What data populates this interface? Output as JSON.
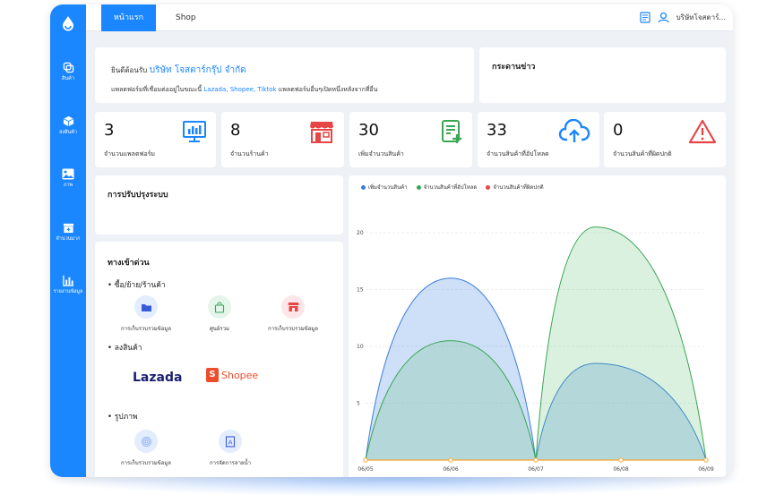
{
  "topbar": {
    "tabs": [
      {
        "label": "หน้าแรก"
      },
      {
        "label": "Shop"
      }
    ],
    "company": "บริษัทโจสตาร์..."
  },
  "sidebar": {
    "items": [
      {
        "label": "สินค้า"
      },
      {
        "label": "ลงสินค้า"
      },
      {
        "label": "ภาพ"
      },
      {
        "label": "จำนวนมาก"
      },
      {
        "label": "รายงานข้อมูล"
      }
    ]
  },
  "welcome": {
    "prefix": "ยินดีต้อนรับ",
    "company": "บริษัท โจสตาร์กรุ๊ป จำกัด",
    "line2_prefix": "แพลตฟอร์มที่เชื่อมต่ออยู่ในขณะนี้",
    "platforms": "Lazada, Shopee, Tiktok",
    "line2_suffix": "แพลตฟอร์มอื่นๆเปิดหนึ่งหลังจากที่อื่น"
  },
  "news": {
    "title": "กระดานข่าว"
  },
  "stats": [
    {
      "value": "3",
      "label": "จำนวนแพลตฟอร์ม"
    },
    {
      "value": "8",
      "label": "จำนวนร้านค้า"
    },
    {
      "value": "30",
      "label": "เพิ่มจำนวนสินค้า"
    },
    {
      "value": "33",
      "label": "จำนวนสินค้าที่อัปโหลด"
    },
    {
      "value": "0",
      "label": "จำนวนสินค้าที่ผิดปกติ"
    }
  ],
  "updates": {
    "title": "การปรับปรุงระบบ"
  },
  "quick_access": {
    "title": "ทางเข้าด่วน",
    "sections": [
      {
        "label": "• ซื้อ/ย้าย/ร้านค้า",
        "items": [
          {
            "label": "การเก็บรวบรวมข้อมูล"
          },
          {
            "label": "ศูนย์รวม"
          },
          {
            "label": "การเก็บรวบรวมข้อมูล"
          }
        ]
      },
      {
        "label": "• ลงสินค้า",
        "items": [
          {
            "label": "Lazada"
          },
          {
            "label": "Shopee"
          }
        ]
      },
      {
        "label": "• รูปภาพ",
        "items": [
          {
            "label": "การเก็บรวบรวมข้อมูล"
          },
          {
            "label": "การจัดการลายน้ำ"
          }
        ]
      }
    ]
  },
  "colors": {
    "accent": "#1a86ff",
    "blue_series": "#3b7ddd",
    "green_series": "#3aa655",
    "red_series": "#e64646",
    "orange_series": "#f2a531"
  },
  "chart_data": {
    "type": "area",
    "categories": [
      "06/05",
      "06/06",
      "06/07",
      "06/08",
      "06/09"
    ],
    "yticks": [
      5,
      10,
      15,
      20
    ],
    "ylim": [
      0,
      20
    ],
    "series": [
      {
        "name": "เพิ่มจำนวนสินค้า",
        "color": "#3b7ddd",
        "fill": "rgba(80,140,230,0.28)",
        "points": [
          [
            0,
            0
          ],
          [
            1,
            16
          ],
          [
            2,
            0
          ],
          [
            2.7,
            8.5
          ],
          [
            4,
            0
          ]
        ]
      },
      {
        "name": "จำนวนสินค้าที่อัปโหลด",
        "color": "#3aa655",
        "fill": "rgba(90,190,110,0.22)",
        "points": [
          [
            0,
            0
          ],
          [
            1,
            10.5
          ],
          [
            2,
            0
          ],
          [
            2.7,
            20.5
          ],
          [
            4,
            0
          ]
        ]
      },
      {
        "name": "จำนวนสินค้าที่ผิดปกติ",
        "color": "#e64646",
        "fill": "none",
        "points": [
          [
            0,
            0
          ],
          [
            1,
            0
          ],
          [
            2,
            0
          ],
          [
            3,
            0
          ],
          [
            4,
            0
          ]
        ]
      }
    ]
  }
}
